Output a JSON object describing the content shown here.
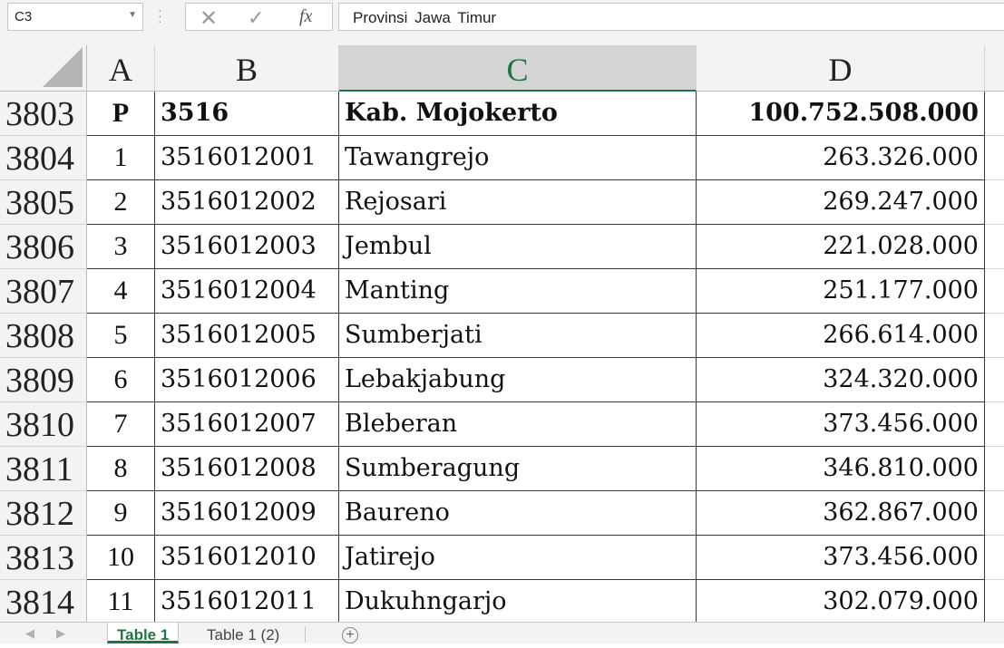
{
  "formula_bar": {
    "name_box": "C3",
    "cancel_icon": "✕",
    "enter_icon": "✓",
    "function_icon": "fx",
    "formula_value": "Provinsi  Jawa  Timur"
  },
  "columns": [
    {
      "label": "A",
      "selected": false
    },
    {
      "label": "B",
      "selected": false
    },
    {
      "label": "C",
      "selected": true
    },
    {
      "label": "D",
      "selected": false
    }
  ],
  "rows": [
    {
      "num": "3803",
      "a": "P",
      "b": "3516",
      "c": "Kab.  Mojokerto",
      "d": "100.752.508.000",
      "bold": true
    },
    {
      "num": "3804",
      "a": "1",
      "b": "3516012001",
      "c": "Tawangrejo",
      "d": "263.326.000"
    },
    {
      "num": "3805",
      "a": "2",
      "b": "3516012002",
      "c": "Rejosari",
      "d": "269.247.000"
    },
    {
      "num": "3806",
      "a": "3",
      "b": "3516012003",
      "c": "Jembul",
      "d": "221.028.000"
    },
    {
      "num": "3807",
      "a": "4",
      "b": "3516012004",
      "c": "Manting",
      "d": "251.177.000"
    },
    {
      "num": "3808",
      "a": "5",
      "b": "3516012005",
      "c": "Sumberjati",
      "d": "266.614.000"
    },
    {
      "num": "3809",
      "a": "6",
      "b": "3516012006",
      "c": "Lebakjabung",
      "d": "324.320.000"
    },
    {
      "num": "3810",
      "a": "7",
      "b": "3516012007",
      "c": "Bleberan",
      "d": "373.456.000"
    },
    {
      "num": "3811",
      "a": "8",
      "b": "3516012008",
      "c": "Sumberagung",
      "d": "346.810.000"
    },
    {
      "num": "3812",
      "a": "9",
      "b": "3516012009",
      "c": "Baureno",
      "d": "362.867.000"
    },
    {
      "num": "3813",
      "a": "10",
      "b": "3516012010",
      "c": "Jatirejo",
      "d": "373.456.000"
    },
    {
      "num": "3814",
      "a": "11",
      "b": "3516012011",
      "c": "Dukuhngarjo",
      "d": "302.079.000"
    }
  ],
  "sheet_tabs": [
    {
      "label": "Table 1",
      "active": true
    },
    {
      "label": "Table 1 (2)",
      "active": false
    }
  ],
  "accent_color": "#217346"
}
